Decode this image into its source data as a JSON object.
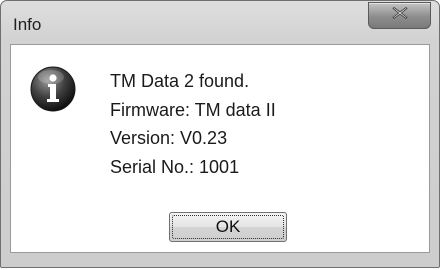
{
  "window": {
    "title": "Info"
  },
  "titlebar": {
    "close_icon": "close-x-icon"
  },
  "message": {
    "icon": "information-icon",
    "lines": [
      "TM Data 2 found.",
      "Firmware: TM data II",
      "Version: V0.23",
      "Serial No.: 1001"
    ]
  },
  "buttons": {
    "ok_label": "OK"
  }
}
